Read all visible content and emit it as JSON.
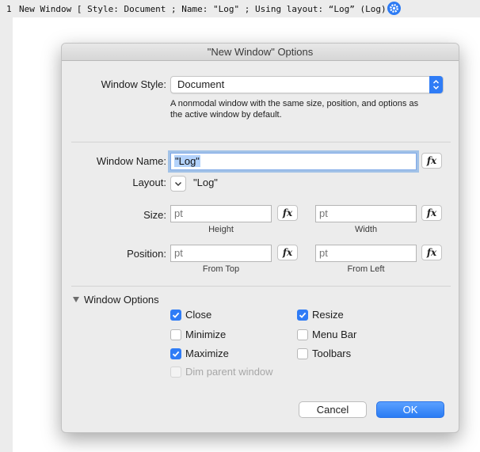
{
  "script": {
    "line_number": "1",
    "text": "New Window [ Style: Document ; Name: \"Log\" ; Using layout: “Log” (Log) ]"
  },
  "dialog": {
    "title": "\"New Window\" Options",
    "window_style": {
      "label": "Window Style:",
      "value": "Document",
      "description_line1": "A nonmodal window with the same size, position, and options as",
      "description_line2": "the active window by default."
    },
    "window_name": {
      "label": "Window Name:",
      "value": "\"Log\"",
      "fx": "fx"
    },
    "layout": {
      "label": "Layout:",
      "value": "\"Log\""
    },
    "size": {
      "label": "Size:",
      "height_placeholder": "pt",
      "width_placeholder": "pt",
      "height_caption": "Height",
      "width_caption": "Width",
      "fx": "fx"
    },
    "position": {
      "label": "Position:",
      "top_placeholder": "pt",
      "left_placeholder": "pt",
      "top_caption": "From Top",
      "left_caption": "From Left",
      "fx": "fx"
    },
    "window_options": {
      "header": "Window Options",
      "options": [
        {
          "label": "Close",
          "checked": true
        },
        {
          "label": "Resize",
          "checked": true
        },
        {
          "label": "Minimize",
          "checked": false
        },
        {
          "label": "Menu Bar",
          "checked": false
        },
        {
          "label": "Maximize",
          "checked": true
        },
        {
          "label": "Toolbars",
          "checked": false
        },
        {
          "label": "Dim parent window",
          "checked": false,
          "disabled": true
        }
      ]
    },
    "buttons": {
      "cancel": "Cancel",
      "ok": "OK"
    }
  },
  "colors": {
    "accent": "#2f7cf6",
    "background": "#ececec"
  }
}
